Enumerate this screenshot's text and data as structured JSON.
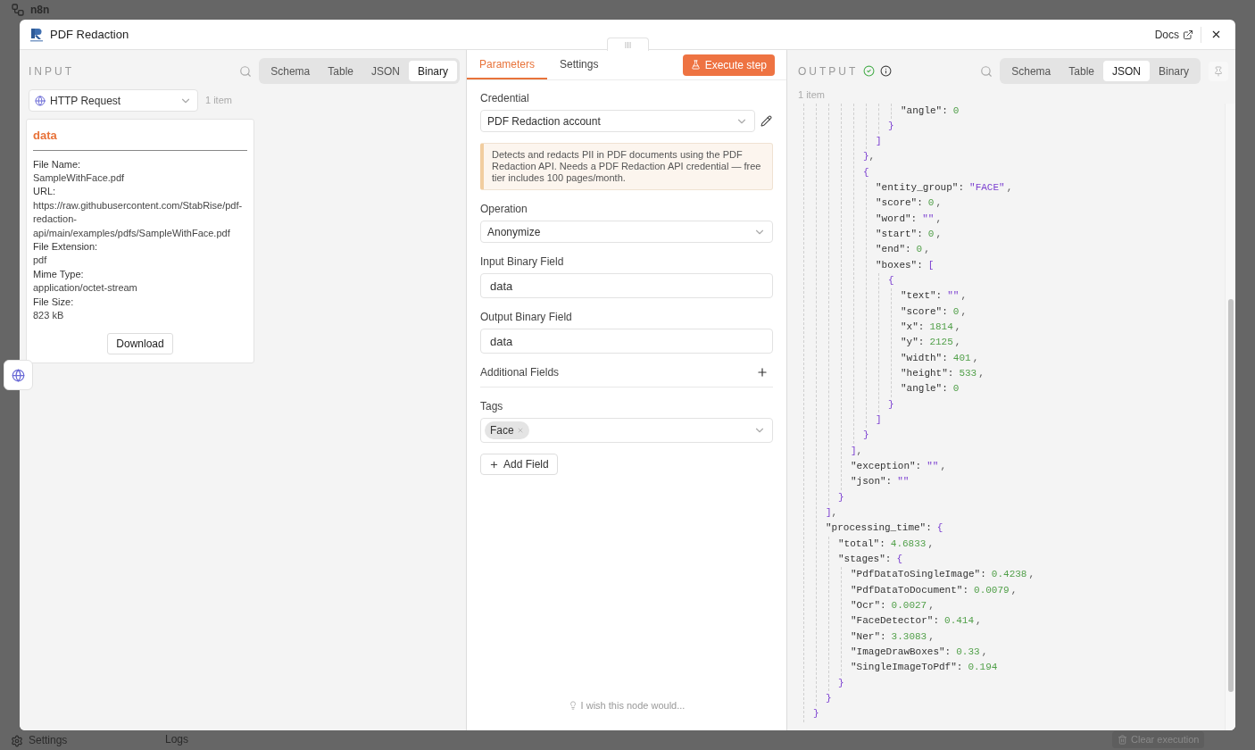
{
  "background": {
    "brand": "n8n",
    "sidebar_item": "Settings",
    "logs": "Logs",
    "clear_button": "Clear execution"
  },
  "modal": {
    "title": "PDF Redaction",
    "docs_link": "Docs"
  },
  "input": {
    "heading": "INPUT",
    "tabs": [
      {
        "label": "Schema",
        "selected": false
      },
      {
        "label": "Table",
        "selected": false
      },
      {
        "label": "JSON",
        "selected": false
      },
      {
        "label": "Binary",
        "selected": true
      }
    ],
    "source": "HTTP Request",
    "count": "1 item",
    "binary": {
      "name": "data",
      "fields": [
        {
          "label": "File Name:",
          "value": "SampleWithFace.pdf"
        },
        {
          "label": "URL:",
          "value": "https://raw.githubusercontent.com/StabRise/pdf-redaction-api/main/examples/pdfs/SampleWithFace.pdf"
        },
        {
          "label": "File Extension:",
          "value": "pdf"
        },
        {
          "label": "Mime Type:",
          "value": "application/octet-stream"
        },
        {
          "label": "File Size:",
          "value": "823 kB"
        }
      ],
      "download": "Download"
    }
  },
  "parameters": {
    "tabs": [
      {
        "label": "Parameters",
        "selected": true
      },
      {
        "label": "Settings",
        "selected": false
      }
    ],
    "execute": "Execute step",
    "fields": [
      {
        "kind": "credential",
        "label": "Credential",
        "value": "PDF Redaction account"
      },
      {
        "kind": "notice",
        "text": "Detects and redacts PII in PDF documents using the PDF Redaction API. Needs a PDF Redaction API credential — free tier includes 100 pages/month."
      },
      {
        "kind": "select",
        "label": "Operation",
        "value": "Anonymize"
      },
      {
        "kind": "text",
        "label": "Input Binary Field",
        "value": "data"
      },
      {
        "kind": "text",
        "label": "Output Binary Field",
        "value": "data"
      },
      {
        "kind": "collection",
        "label": "Additional Fields"
      },
      {
        "kind": "tags",
        "label": "Tags",
        "tags": [
          "Face"
        ]
      },
      {
        "kind": "add",
        "label": "Add Field"
      }
    ],
    "feedback": "I wish this node would..."
  },
  "output": {
    "heading": "OUTPUT",
    "success": true,
    "tabs": [
      {
        "label": "Schema",
        "selected": false
      },
      {
        "label": "Table",
        "selected": false
      },
      {
        "label": "JSON",
        "selected": true
      },
      {
        "label": "Binary",
        "selected": false
      }
    ],
    "count": "1 item",
    "json": [
      {
        "kind": "block",
        "children": [
          {
            "kind": "block",
            "close": "}",
            "children": [
              {
                "kind": "block",
                "close": "]",
                "tail": ",",
                "children": [
                  {
                    "kind": "block",
                    "close": "}",
                    "children": [
                      {
                        "kind": "block",
                        "close": "]",
                        "tail": ",",
                        "children": [
                          {
                            "kind": "block",
                            "close": "}",
                            "tail": ",",
                            "children": [
                              {
                                "kind": "block",
                                "close": "]",
                                "children": [
                                  {
                                    "kind": "block",
                                    "close": "}",
                                    "children": [
                                      {
                                        "kind": "number",
                                        "key": "\"angle\":",
                                        "value": "0"
                                      }
                                    ]
                                  }
                                ]
                              }
                            ]
                          },
                          {
                            "kind": "block",
                            "bracket": "{",
                            "close": "}",
                            "children": [
                              {
                                "kind": "string",
                                "key": "\"entity_group\":",
                                "value": "\"FACE\"",
                                "tail": ","
                              },
                              {
                                "kind": "number",
                                "key": "\"score\":",
                                "value": "0",
                                "tail": ","
                              },
                              {
                                "kind": "string",
                                "key": "\"word\":",
                                "value": "\"\"",
                                "tail": ","
                              },
                              {
                                "kind": "number",
                                "key": "\"start\":",
                                "value": "0",
                                "tail": ","
                              },
                              {
                                "kind": "number",
                                "key": "\"end\":",
                                "value": "0",
                                "tail": ","
                              },
                              {
                                "kind": "block",
                                "key": "\"boxes\":",
                                "bracket": "[",
                                "close": "]",
                                "children": [
                                  {
                                    "kind": "block",
                                    "bracket": "{",
                                    "close": "}",
                                    "children": [
                                      {
                                        "kind": "string",
                                        "key": "\"text\":",
                                        "value": "\"\"",
                                        "tail": ","
                                      },
                                      {
                                        "kind": "number",
                                        "key": "\"score\":",
                                        "value": "0",
                                        "tail": ","
                                      },
                                      {
                                        "kind": "number",
                                        "key": "\"x\":",
                                        "value": "1814",
                                        "tail": ","
                                      },
                                      {
                                        "kind": "number",
                                        "key": "\"y\":",
                                        "value": "2125",
                                        "tail": ","
                                      },
                                      {
                                        "kind": "number",
                                        "key": "\"width\":",
                                        "value": "401",
                                        "tail": ","
                                      },
                                      {
                                        "kind": "number",
                                        "key": "\"height\":",
                                        "value": "533",
                                        "tail": ","
                                      },
                                      {
                                        "kind": "number",
                                        "key": "\"angle\":",
                                        "value": "0"
                                      }
                                    ]
                                  }
                                ]
                              }
                            ]
                          }
                        ]
                      },
                      {
                        "kind": "string",
                        "key": "\"exception\":",
                        "value": "\"\"",
                        "tail": ","
                      },
                      {
                        "kind": "string",
                        "key": "\"json\":",
                        "value": "\"\""
                      }
                    ]
                  }
                ]
              },
              {
                "kind": "block",
                "key": "\"processing_time\":",
                "bracket": "{",
                "close": "}",
                "children": [
                  {
                    "kind": "number",
                    "key": "\"total\":",
                    "value": "4.6833",
                    "tail": ","
                  },
                  {
                    "kind": "block",
                    "key": "\"stages\":",
                    "bracket": "{",
                    "close": "}",
                    "children": [
                      {
                        "kind": "number",
                        "key": "\"PdfDataToSingleImage\":",
                        "value": "0.4238",
                        "tail": ","
                      },
                      {
                        "kind": "number",
                        "key": "\"PdfDataToDocument\":",
                        "value": "0.0079",
                        "tail": ","
                      },
                      {
                        "kind": "number",
                        "key": "\"Ocr\":",
                        "value": "0.0027",
                        "tail": ","
                      },
                      {
                        "kind": "number",
                        "key": "\"FaceDetector\":",
                        "value": "0.414",
                        "tail": ","
                      },
                      {
                        "kind": "number",
                        "key": "\"Ner\":",
                        "value": "3.3083",
                        "tail": ","
                      },
                      {
                        "kind": "number",
                        "key": "\"ImageDrawBoxes\":",
                        "value": "0.33",
                        "tail": ","
                      },
                      {
                        "kind": "number",
                        "key": "\"SingleImageToPdf\":",
                        "value": "0.194"
                      }
                    ]
                  }
                ]
              }
            ]
          }
        ]
      }
    ]
  }
}
